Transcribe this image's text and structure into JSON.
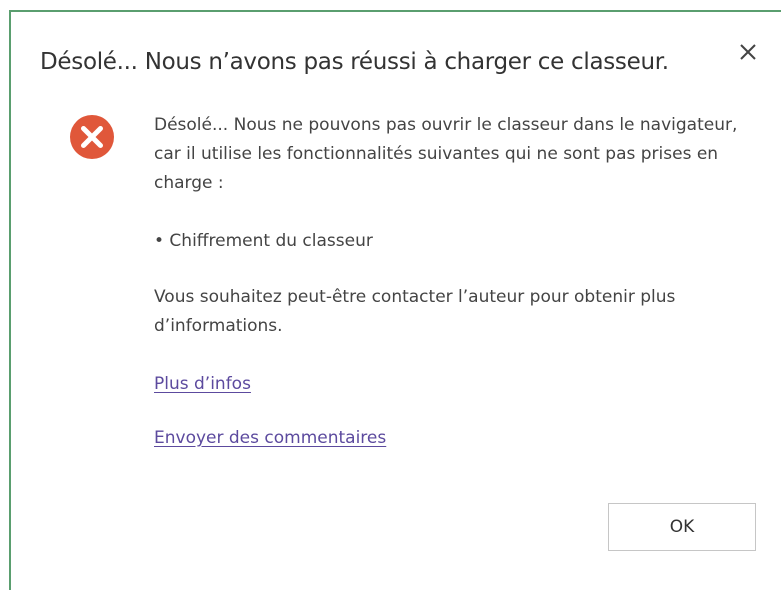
{
  "dialog": {
    "title": "Désolé... Nous n’avons pas réussi à charger ce classeur.",
    "message": "Désolé... Nous ne pouvons pas ouvrir le classeur dans le navigateur, car il utilise les fonctionnalités suivantes qui ne sont pas prises en charge :",
    "bullet": "• Chiffrement du classeur",
    "contact": "Vous souhaitez peut-être contacter l’auteur pour obtenir plus d’informations.",
    "links": {
      "more_info": "Plus d’infos",
      "send_feedback": "Envoyer des commentaires"
    },
    "ok_label": "OK",
    "icons": {
      "error": "error-icon",
      "close": "close-icon"
    }
  },
  "colors": {
    "frame_border": "#5a9e6f",
    "error_red": "#e0573a",
    "link": "#5c4a9e",
    "text": "#444444"
  }
}
